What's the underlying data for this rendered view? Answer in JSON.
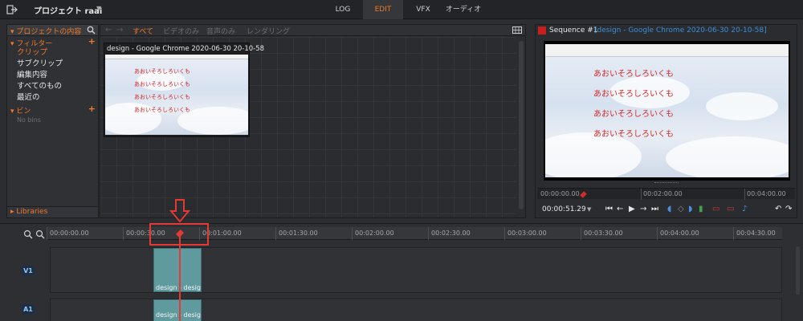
{
  "topbar": {
    "project_title": "プロジェクト raai",
    "tabs": [
      {
        "label": "LOG",
        "active": false
      },
      {
        "label": "EDIT",
        "active": true
      },
      {
        "label": "VFX",
        "active": false
      },
      {
        "label": "オーディオ",
        "active": false
      }
    ]
  },
  "left_panel": {
    "header": "プロジェクトの内容",
    "filters_header": "フィルター",
    "filters": [
      {
        "label": "クリップ",
        "selected": true
      },
      {
        "label": "サブクリップ",
        "selected": false
      },
      {
        "label": "編集内容",
        "selected": false
      },
      {
        "label": "すべてのもの",
        "selected": false
      },
      {
        "label": "最近の",
        "selected": false
      }
    ],
    "bins_header": "ビン",
    "bins_empty": "No bins",
    "libraries": "Libraries"
  },
  "browser": {
    "tabs": [
      {
        "label": "すべて",
        "active": true
      },
      {
        "label": "ビデオのみ",
        "active": false
      },
      {
        "label": "音声のみ",
        "active": false
      },
      {
        "label": "レンダリング",
        "active": false
      }
    ],
    "clip": {
      "title": "design - Google Chrome 2020-06-30 20-10-58",
      "thumb_lines": [
        "あおいそろしろいくも",
        "あおいそろしろいくも",
        "あおいそろしろいくも",
        "あおいそろしろいくも"
      ]
    }
  },
  "viewer": {
    "sequence_name": "Sequence #1",
    "clip_name": "[design - Google Chrome 2020-06-30 20-10-58]",
    "screen_lines": [
      "あおいそろしろいくも",
      "あおいそろしろいくも",
      "あおいそろしろいくも",
      "あおいそろしろいくも"
    ],
    "ruler": [
      "00:00:00.00",
      "00:02:00.00",
      "00:04:00.00"
    ],
    "current_timecode": "00:00:51.29"
  },
  "timeline": {
    "ruler": [
      "00:00:00.00",
      "00:00:30.00",
      "00:01:00.00",
      "00:01:30.00",
      "00:02:00.00",
      "00:02:30.00",
      "00:03:00.00",
      "00:03:30.00",
      "00:04:00.00",
      "00:04:30.00"
    ],
    "tracks": [
      {
        "label": "V1",
        "clip": "design - design"
      },
      {
        "label": "A1",
        "clip": "design - design"
      }
    ]
  },
  "colors": {
    "accent": "#f07a2a",
    "playhead": "#e53935",
    "clip": "#5f9a9e",
    "link": "#3b8ed8"
  }
}
